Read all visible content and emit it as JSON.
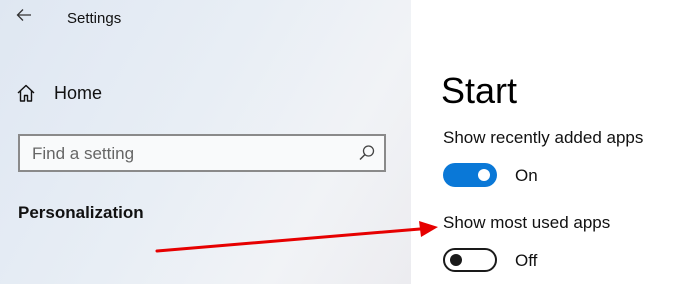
{
  "window": {
    "title": "Settings"
  },
  "sidebar": {
    "home_label": "Home",
    "search_placeholder": "Find a setting",
    "section_label": "Personalization"
  },
  "main": {
    "page_title": "Start",
    "settings": [
      {
        "label": "Show recently added apps",
        "state": "On",
        "toggle_on": true
      },
      {
        "label": "Show most used apps",
        "state": "Off",
        "toggle_on": false
      }
    ]
  },
  "colors": {
    "accent": "#0a78d7",
    "annotation_arrow": "#e60000"
  },
  "icons": {
    "back": "back-arrow-icon",
    "home": "home-icon",
    "search": "search-icon"
  }
}
